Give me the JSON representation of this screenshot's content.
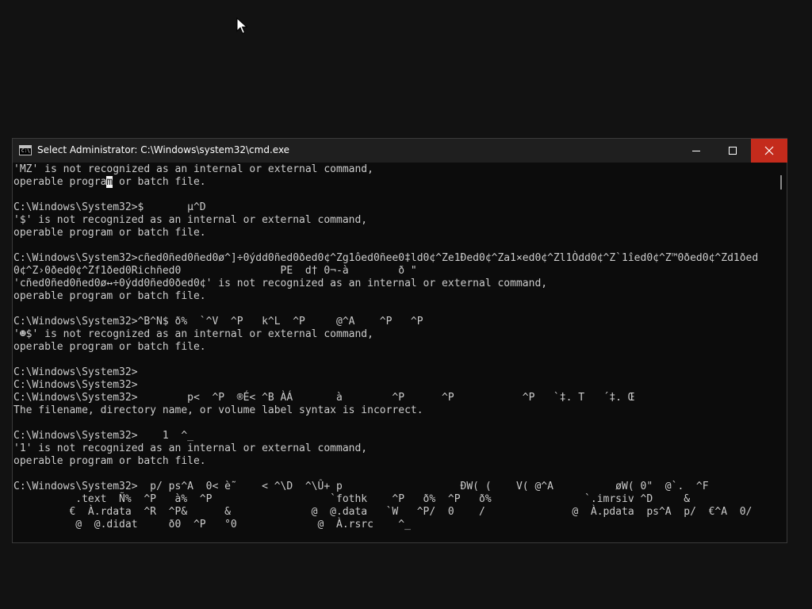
{
  "window": {
    "title": "Select Administrator: C:\\Windows\\system32\\cmd.exe",
    "app_icon": "console-app-icon",
    "buttons": {
      "minimize": "minimize-icon",
      "maximize": "maximize-icon",
      "close": "close-icon"
    },
    "close_color": "#c42b1c"
  },
  "console": {
    "background": "#0c0c0c",
    "text_color": "#cccccc",
    "lines": [
      "'MZ' is not recognized as an internal or external command,",
      "operable program or batch file.",
      "",
      "C:\\Windows\\System32>$       µ^D",
      "'$' is not recognized as an internal or external command,",
      "operable program or batch file.",
      "",
      "C:\\Windows\\System32>cñed0ñed0ñed0ø^]÷0ýdd0ñed0ðed0¢^Zg1ôed0ñee0‡ld0¢^Ze1Ðed0¢^Za1×ed0¢^Zl1Òdd0¢^Z`1îed0¢^Z™0ðed0¢^Zd1ðed",
      "0¢^Z›0ðed0¢^Zf1ðed0Richñed0                PE  d† 0¬-à        ð \"",
      "'cñed0ñed0ñed0ø↔÷0ýdd0ñed0ðed0¢' is not recognized as an internal or external command,",
      "operable program or batch file.",
      "",
      "C:\\Windows\\System32>^B^N$ ð%  `^V  ^P   k^L  ^P     @^A    ^P   ^P",
      "'☻$' is not recognized as an internal or external command,",
      "operable program or batch file.",
      "",
      "C:\\Windows\\System32>",
      "C:\\Windows\\System32>",
      "C:\\Windows\\System32>        p<  ^P  ®É< ^B ÀÁ       à        ^P      ^P           ^P   `‡. T   ´‡. Œ",
      "The filename, directory name, or volume label syntax is incorrect.",
      "",
      "C:\\Windows\\System32>    1  ^_",
      "'1' is not recognized as an internal or external command,",
      "operable program or batch file.",
      "",
      "C:\\Windows\\System32>  p/ ps^A  0< è˜    < ^\\D  ^\\Û+ p                   ÐW( (    V( @^A          øW( 0\"  @`.  ^F",
      "          .text  Ñ%  ^P   à%  ^P                   `fothk    ^P   ð%  ^P   ð%               `.imrsiv ^D     &",
      "         €  À.rdata  ^R  ^P&      &             @  @.data   `W   ^P/  0    /              @  À.pdata  ps^A  p/  €^A  0/",
      "          @  @.didat     ð0  ^P   °0             @  À.rsrc    ^_"
    ],
    "selection": {
      "line": 1,
      "text": "m"
    }
  }
}
